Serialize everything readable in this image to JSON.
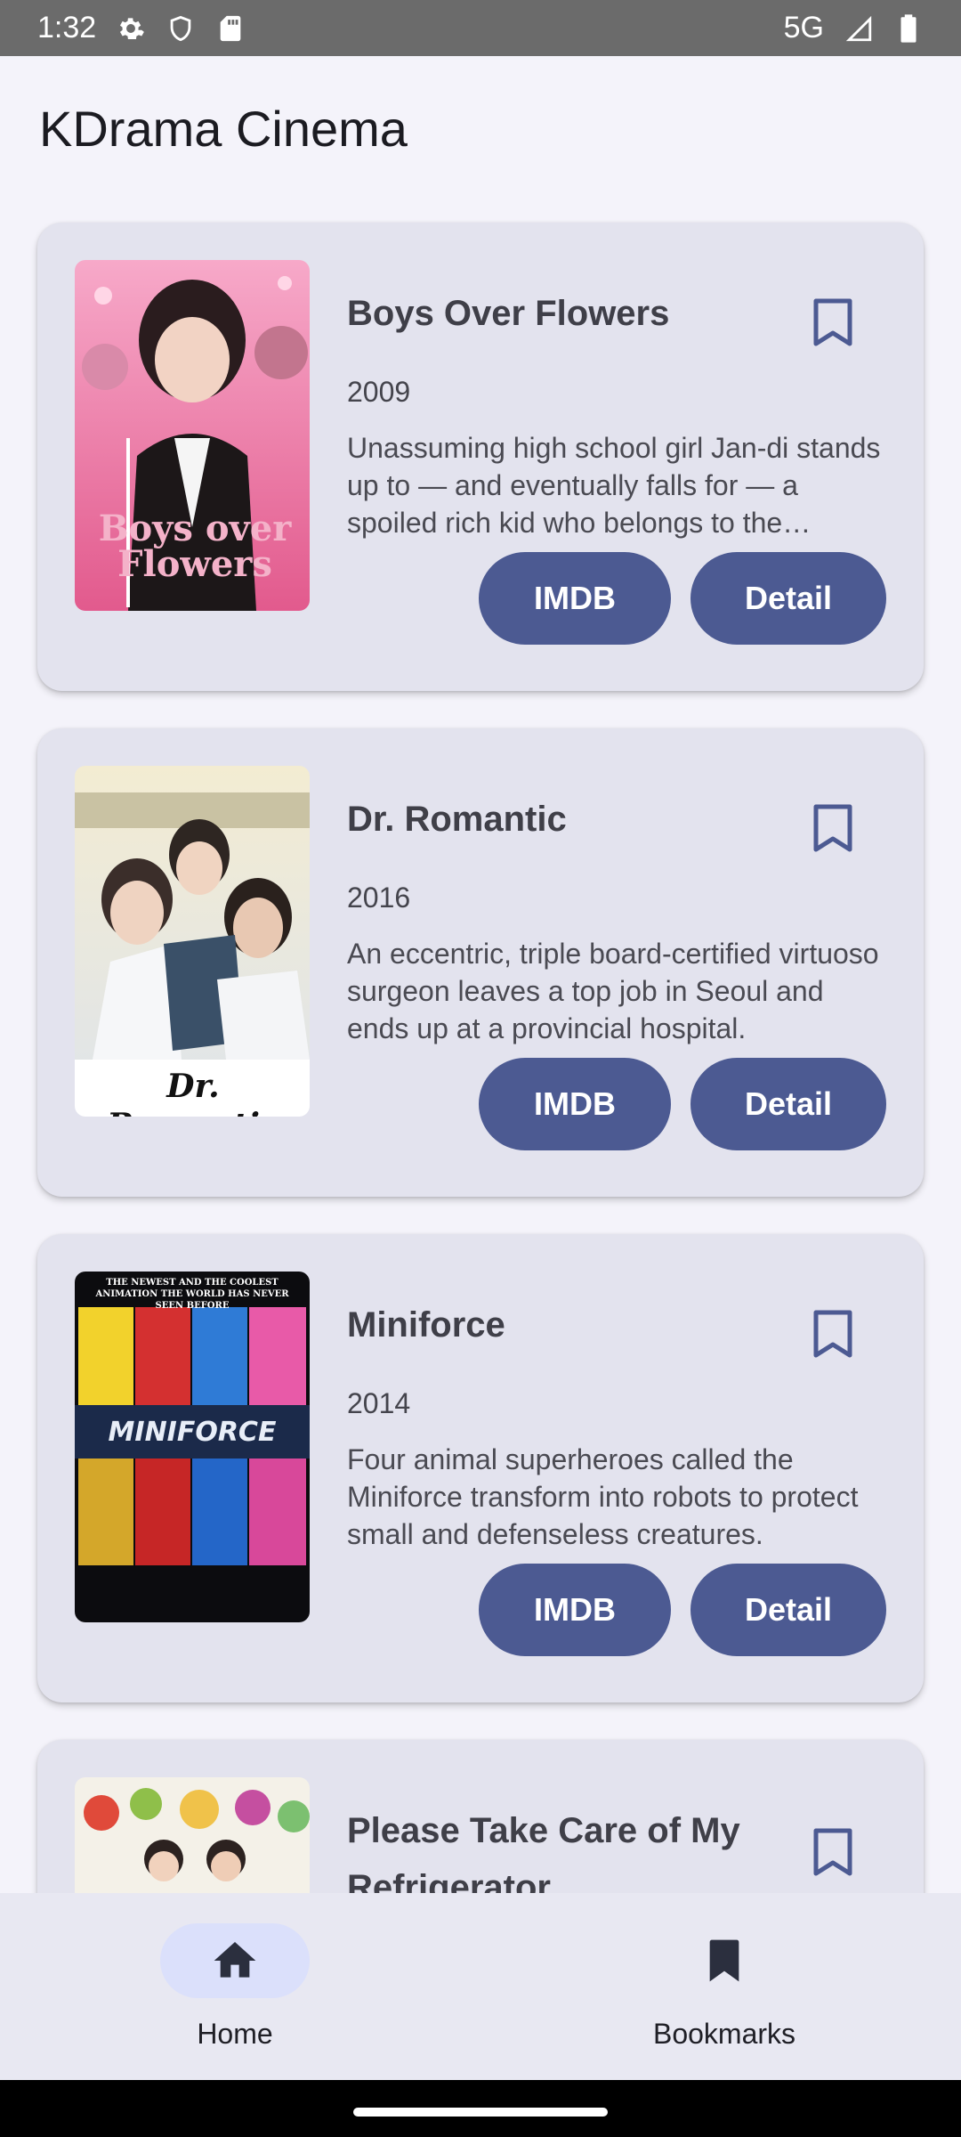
{
  "status_bar": {
    "time": "1:32",
    "network": "5G",
    "icons": [
      "gear-icon",
      "shield-icon",
      "sim-card-icon",
      "signal-icon",
      "battery-icon"
    ]
  },
  "app": {
    "title": "KDrama Cinema"
  },
  "dramas": [
    {
      "title": "Boys Over Flowers",
      "year": "2009",
      "description": "Unassuming high school girl Jan-di stands up to — and eventually falls for — a spoiled rich kid who belongs to the school's most powerful clique.",
      "imdb_label": "IMDB",
      "detail_label": "Detail",
      "poster_text": "Boys over Flowers"
    },
    {
      "title": "Dr. Romantic",
      "year": "2016",
      "description": "An eccentric, triple board-certified virtuoso surgeon leaves a top job in Seoul and ends up at a provincial hospital.",
      "imdb_label": "IMDB",
      "detail_label": "Detail",
      "poster_text": "Dr. Romantic"
    },
    {
      "title": "Miniforce",
      "year": "2014",
      "description": "Four animal superheroes called the Miniforce transform into robots to protect small and defenseless creatures.",
      "imdb_label": "IMDB",
      "detail_label": "Detail",
      "poster_text": "MINIFORCE",
      "poster_caption": "THE NEWEST AND THE COOLEST ANIMATION THE WORLD HAS NEVER SEEN BEFORE"
    },
    {
      "title": "Please Take Care of My Refrigerator"
    }
  ],
  "bottom_nav": {
    "home_label": "Home",
    "bookmarks_label": "Bookmarks",
    "selected": "Home"
  },
  "colors": {
    "accent": "#4c5a92",
    "card_bg": "#e3e3ee",
    "page_bg": "#f4f3fa",
    "nav_selected_pill": "#dbe0fb"
  }
}
